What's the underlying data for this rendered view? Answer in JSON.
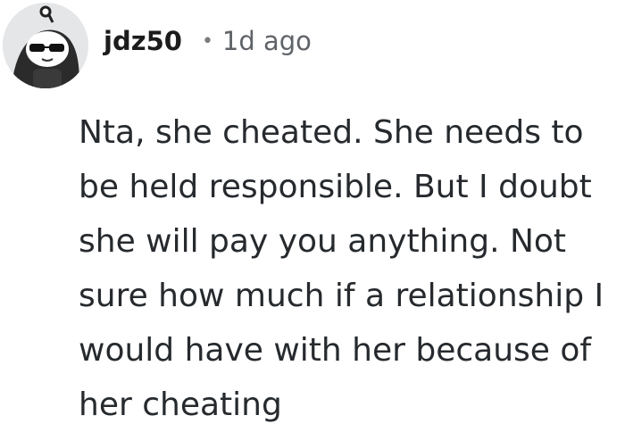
{
  "comment": {
    "author": "jdz50",
    "separator": "•",
    "timestamp": "1d ago",
    "avatar_icon": "snoo-sunglasses-avatar-icon",
    "text": "Nta, she cheated. She needs to be held responsible. But I doubt she will pay you anything. Not sure how much if a relationship I would have with her because of her cheating"
  },
  "colors": {
    "username": "#1c1c1c",
    "timestamp": "#5f6368",
    "body_text": "#262a2e",
    "avatar_bg": "#e4e6e8"
  }
}
